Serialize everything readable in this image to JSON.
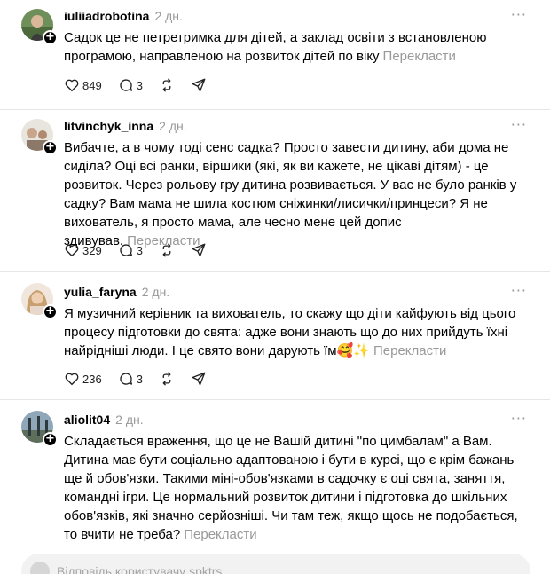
{
  "feed": {
    "translate_label": "Перекласти",
    "posts": [
      {
        "username": "iuliiadrobotina",
        "time": "2 дн.",
        "text": "Садок це не петретримка для дітей, а заклад освіти з встановленою програмою, направленою на розвиток дітей по віку",
        "likes": "849",
        "replies": "3"
      },
      {
        "username": "litvinchyk_inna",
        "time": "2 дн.",
        "text": "Вибачте, а в чому тоді сенс садка? Просто завести дитину, аби дома не сиділа? Оці всі ранки, віршики (які, як ви кажете, не цікаві дітям) - це розвиток. Через рольову гру дитина розвивається. У вас не було ранків у садку? Вам мама не шила костюм сніжинки/лисички/принцеси? Я не вихователь, я просто мама, але чесно мене цей допис здивував.",
        "likes": "329",
        "replies": "3"
      },
      {
        "username": "yulia_faryna",
        "time": "2 дн.",
        "text": "Я музичний керівник та вихователь, то скажу що діти кайфують від цього процесу підготовки до свята: адже вони знають що до них прийдуть їхні найрідніші люди. І це свято вони дарують їм🥰✨",
        "likes": "236",
        "replies": "3"
      },
      {
        "username": "aliolit04",
        "time": "2 дн.",
        "text": "Складається враження, що це не Вашій дитині \"по цимбалам\" а Вам. Дитина має бути соціально адаптованою і бути в курсі, що є крім бажань ще й обов'язки. Такими міні-обов'язками в садочку є оці свята, заняття, командні ігри. Це нормальний розвиток дитини і підготовка до шкільних обов'язків, які значно серйозніші. Чи там теж, якщо щось не подобається, то вчити не треба?"
      }
    ]
  },
  "reply_bar": {
    "placeholder": "Відповідь користувачу spktrs"
  },
  "icons": {
    "like": "heart-icon",
    "reply": "comment-icon",
    "repost": "repost-icon",
    "share": "send-icon",
    "more": "more-icon",
    "follow": "plus-badge-icon"
  },
  "colors": {
    "muted_text": "#999999",
    "divider": "#e6e6e6",
    "reply_bar_bg": "#f2f2f2"
  }
}
